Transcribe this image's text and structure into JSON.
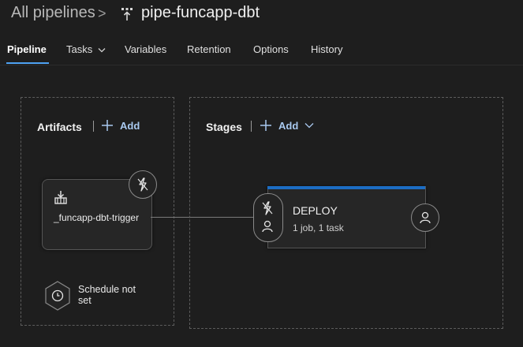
{
  "breadcrumb": {
    "root": "All pipelines",
    "separator": ">",
    "title": "pipe-funcapp-dbt",
    "title_icon": "pipeline-icon"
  },
  "tabs": [
    {
      "label": "Pipeline",
      "active": true
    },
    {
      "label": "Tasks",
      "has_dropdown": true
    },
    {
      "label": "Variables"
    },
    {
      "label": "Retention"
    },
    {
      "label": "Options"
    },
    {
      "label": "History"
    }
  ],
  "artifacts": {
    "title": "Artifacts",
    "add_label": "Add",
    "item": {
      "name": "_funcapp-dbt-trigger",
      "icon": "build-artifact-icon",
      "trigger_icon": "lightning-icon"
    },
    "schedule": {
      "label": "Schedule not set",
      "icon": "clock-icon"
    }
  },
  "stages": {
    "title": "Stages",
    "add_label": "Add",
    "stage": {
      "name": "DEPLOY",
      "summary": "1 job, 1 task",
      "accent": "#1c6dc3"
    }
  },
  "colors": {
    "background": "#1e1e1e",
    "active_tab_underline": "#4ea1f3",
    "link": "#a9c9ef"
  }
}
